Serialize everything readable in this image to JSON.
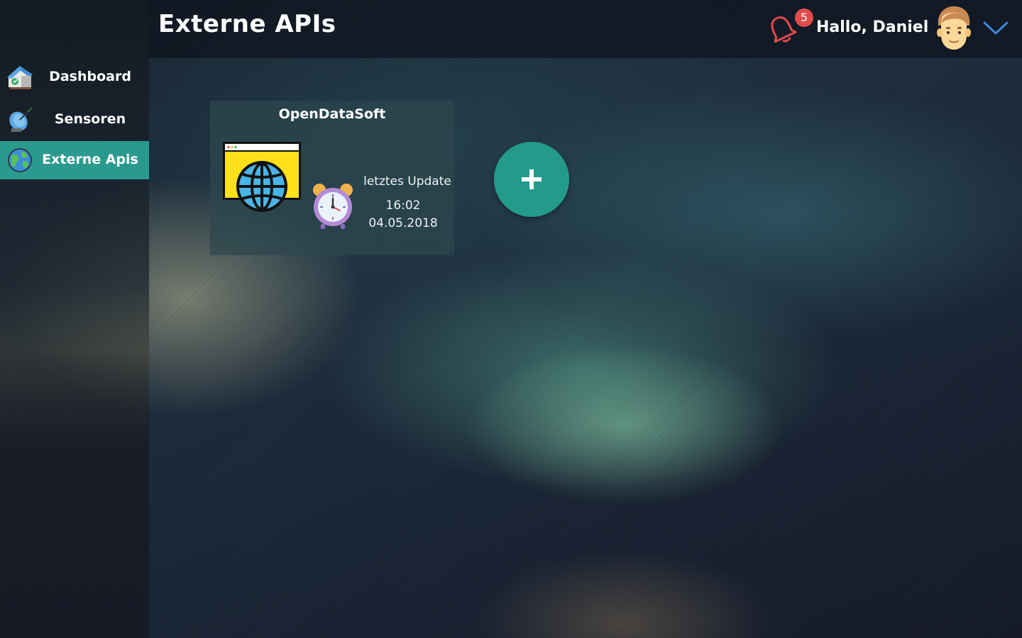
{
  "header": {
    "title": "Externe APIs",
    "notification_count": "5",
    "greeting": "Hallo, Daniel",
    "icons": {
      "bell": "bell-icon",
      "avatar": "user-avatar",
      "menu": "chevron-down-icon"
    }
  },
  "sidebar": {
    "items": [
      {
        "label": "Dashboard",
        "icon": "house-icon",
        "active": false
      },
      {
        "label": "Sensoren",
        "icon": "satellite-dish-icon",
        "active": false
      },
      {
        "label": "Externe Apis",
        "icon": "globe-icon",
        "active": true
      }
    ]
  },
  "cards": [
    {
      "title": "OpenDataSoft",
      "icon": "browser-globe-icon",
      "update_label": "letztes Update",
      "update_time": "16:02",
      "update_date": "04.05.2018"
    }
  ],
  "add_button": {
    "icon": "plus-icon"
  },
  "colors": {
    "accent": "#2a9a8e",
    "badge": "#e24b4b",
    "bell": "#e24b4b",
    "chevron": "#3c86d8"
  }
}
